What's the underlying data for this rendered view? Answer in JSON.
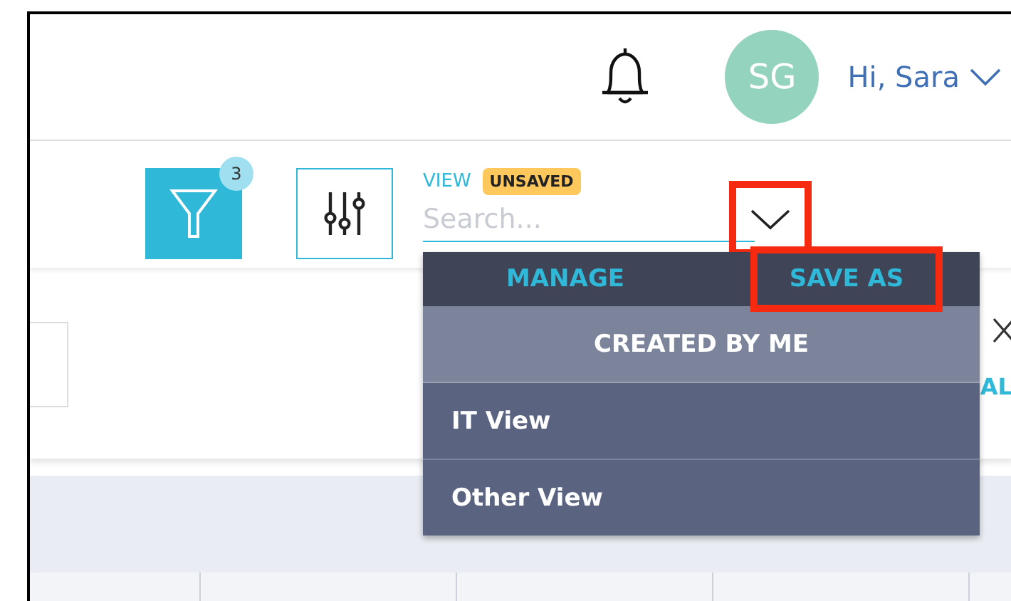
{
  "header": {
    "user": {
      "initials": "SG",
      "greeting": "Hi, Sara"
    }
  },
  "toolbar": {
    "filter_badge": "3",
    "view_label": "VIEW",
    "view_status": "UNSAVED",
    "search": {
      "placeholder": "Search..."
    },
    "view_dropdown_highlighted": true
  },
  "view_menu": {
    "actions": [
      {
        "label": "MANAGE",
        "highlighted": false
      },
      {
        "label": "SAVE AS",
        "highlighted": true
      }
    ],
    "section": "CREATED BY ME",
    "items": [
      {
        "label": "IT View"
      },
      {
        "label": "Other View"
      }
    ]
  },
  "panel": {
    "cut_label": "AL"
  }
}
